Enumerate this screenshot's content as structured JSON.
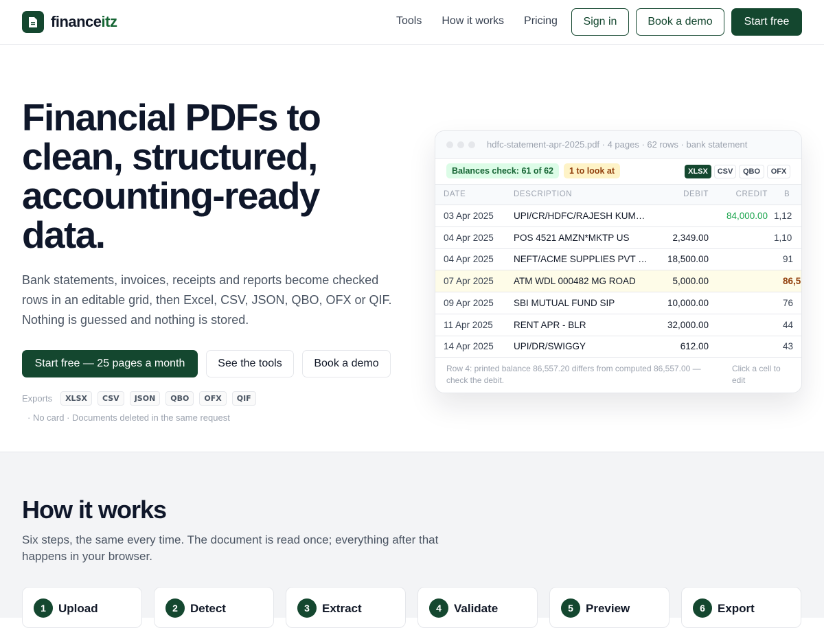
{
  "brand": {
    "name_main": "finance",
    "name_accent": "itz"
  },
  "nav": {
    "links": [
      "Tools",
      "How it works",
      "Pricing"
    ],
    "sign_in": "Sign in",
    "book_demo": "Book a demo",
    "start_free": "Start free"
  },
  "hero": {
    "title": "Financial PDFs to clean, structured, accounting-ready data.",
    "subtitle": "Bank statements, invoices, receipts and reports become checked rows in an editable grid, then Excel, CSV, JSON, QBO, OFX or QIF. Nothing is guessed and nothing is stored.",
    "cta_primary": "Start free — 25 pages a month",
    "cta_tools": "See the tools",
    "cta_demo": "Book a demo",
    "exports_label": "Exports",
    "export_formats": [
      "XLSX",
      "CSV",
      "JSON",
      "QBO",
      "OFX",
      "QIF"
    ],
    "note": "· No card · Documents deleted in the same request"
  },
  "preview": {
    "file_meta": "hdfc-statement-apr-2025.pdf · 4 pages · 62 rows · bank statement",
    "balance_badge": "Balances check: 61 of 62",
    "warn_badge": "1 to look at",
    "formats": [
      "XLSX",
      "CSV",
      "QBO",
      "OFX"
    ],
    "columns": [
      "DATE",
      "DESCRIPTION",
      "DEBIT",
      "CREDIT",
      "B"
    ],
    "rows": [
      {
        "date": "03 Apr 2025",
        "desc": "UPI/CR/HDFC/RAJESH KUMAR/SALARY",
        "debit": "",
        "credit": "84,000.00",
        "bal": "1,12"
      },
      {
        "date": "04 Apr 2025",
        "desc": "POS 4521 AMZN*MKTP US",
        "debit": "2,349.00",
        "credit": "",
        "bal": "1,10"
      },
      {
        "date": "04 Apr 2025",
        "desc": "NEFT/ACME SUPPLIES PVT LTD/INV",
        "debit": "18,500.00",
        "credit": "",
        "bal": "91"
      },
      {
        "date": "07 Apr 2025",
        "desc": "ATM WDL 000482 MG ROAD",
        "debit": "5,000.00",
        "credit": "",
        "bal": "86,5"
      },
      {
        "date": "09 Apr 2025",
        "desc": "SBI MUTUAL FUND SIP",
        "debit": "10,000.00",
        "credit": "",
        "bal": "76"
      },
      {
        "date": "11 Apr 2025",
        "desc": "RENT APR - BLR",
        "debit": "32,000.00",
        "credit": "",
        "bal": "44"
      },
      {
        "date": "14 Apr 2025",
        "desc": "UPI/DR/SWIGGY",
        "debit": "612.00",
        "credit": "",
        "bal": "43"
      }
    ],
    "footer_note": "Row 4: printed balance 86,557.20 differs from computed 86,557.00 — check the debit.",
    "footer_hint": "Click a cell to edit"
  },
  "how": {
    "title": "How it works",
    "subtitle": "Six steps, the same every time. The document is read once; everything after that happens in your browser.",
    "steps": [
      {
        "num": "1",
        "label": "Upload"
      },
      {
        "num": "2",
        "label": "Detect"
      },
      {
        "num": "3",
        "label": "Extract"
      },
      {
        "num": "4",
        "label": "Validate"
      },
      {
        "num": "5",
        "label": "Preview"
      },
      {
        "num": "6",
        "label": "Export"
      }
    ]
  },
  "colors": {
    "brand": "#14472f",
    "credit": "#16a34a",
    "warn": "#92400e",
    "highlight_row": "#fefce8"
  }
}
